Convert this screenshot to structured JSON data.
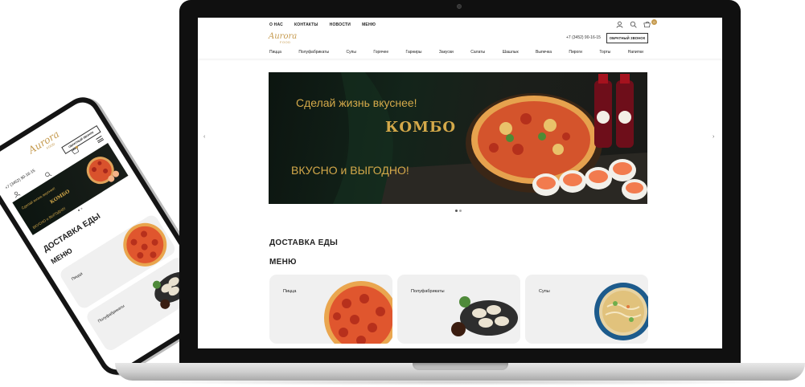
{
  "site": {
    "top_nav": [
      "О НАС",
      "КОНТАКТЫ",
      "НОВОСТИ",
      "МЕНЮ"
    ],
    "logo_text": "Aurora",
    "logo_sub": "FOOD",
    "phone": "+7 (3452) 90-16-15",
    "callback_label": "ОБРАТНЫЙ ЗВОНОК",
    "cart_count": "0",
    "menu": [
      "Пицца",
      "Полуфабрикаты",
      "Супы",
      "Горячее",
      "Гарниры",
      "Закуски",
      "Салаты",
      "Шашлык",
      "Выпечка",
      "Пироги",
      "Торты",
      "Напитки"
    ],
    "banner": {
      "line1": "Сделай жизнь вкуснее!",
      "line2": "КОМБО",
      "line3": "ВКУСНО и ВЫГОДНО!"
    },
    "arrow_left": "‹",
    "arrow_right": "›",
    "delivery_title": "ДОСТАВКА ЕДЫ",
    "menu_title": "МЕНЮ",
    "cards": [
      "Пицца",
      "Полуфабрикаты",
      "Супы"
    ]
  },
  "mobile": {
    "phone": "+7 (3452) 90-16-15",
    "callback_label": "ОБРАТНЫЙ ЗВОНОК",
    "title1": "ДОСТАВКА ЕДЫ",
    "title2": "МЕНЮ",
    "cards": [
      "Пицца",
      "Полуфабрикаты"
    ]
  },
  "colors": {
    "gold": "#c59a4e",
    "banner_text": "#d4a94a",
    "card_bg": "#f0f0f0"
  }
}
